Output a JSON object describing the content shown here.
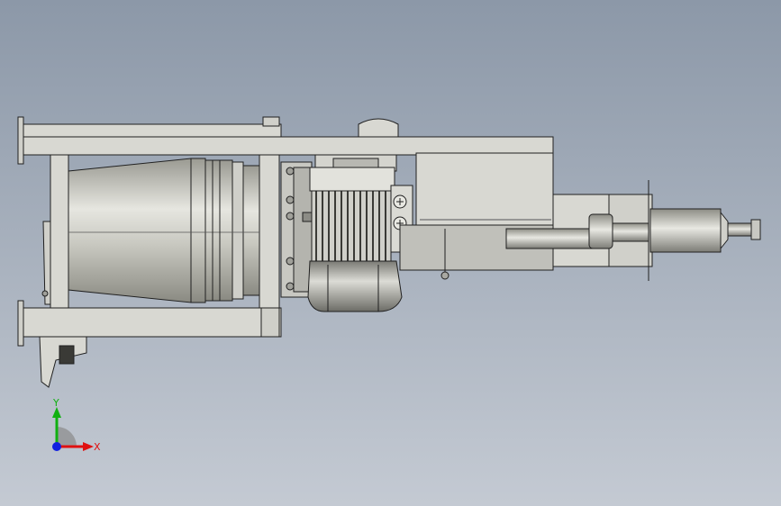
{
  "viewport": {
    "background_top": "#8c98a8",
    "background_bottom": "#c4cad3"
  },
  "model": {
    "part_fill": "#d8d8d2",
    "part_edge": "#202020",
    "shaded_metal": "#b8b8b0"
  },
  "triad": {
    "x_label": "X",
    "y_label": "Y",
    "x_color": "#e01010",
    "y_color": "#10b010",
    "z_color": "#1020e0"
  }
}
